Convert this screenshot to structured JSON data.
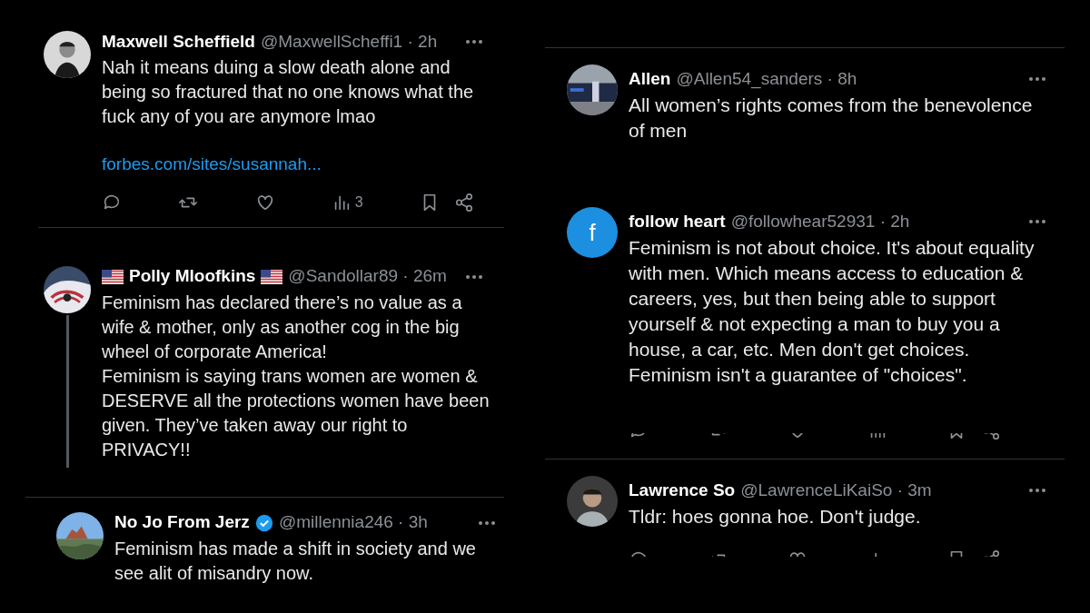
{
  "columns": [
    {
      "tweets": [
        {
          "name": "Maxwell Scheffield",
          "meta": "@MaxwellScheffi1 · 2h",
          "text": "Nah it means duing a slow death alone and being so fractured that no one knows what the fuck any of you are anymore lmao",
          "link": "forbes.com/sites/susannah...",
          "views": "3",
          "actions": true
        },
        {
          "name": "Polly Mloofkins",
          "flags": true,
          "meta": "@Sandollar89 · 26m",
          "text": "Feminism has declared there’s no value as a wife & mother, only as another cog in the big wheel of corporate America!\nFeminism is saying trans women are women & DESERVE all the protections women have been given. They’ve taken away our right to PRIVACY!!",
          "thread_line": true
        },
        {
          "name": "No Jo From Jerz",
          "verified": true,
          "meta": "@millennia246 · 3h",
          "text": "Feminism has made a shift in society and we see alit of misandry now."
        }
      ]
    },
    {
      "tweets": [
        {
          "name": "Allen",
          "meta": "@Allen54_sanders · 8h",
          "text": "All women’s rights comes from the benevolence of men"
        },
        {
          "name": "follow heart",
          "meta": "@followhear52931 · 2h",
          "avatar": {
            "kind": "letter",
            "letter": "f",
            "color": "#1d8fe0"
          },
          "text": "Feminism is not about choice. It's about equality with men. Which means access to education & careers, yes, but then being able to support yourself & not expecting a man to buy you a house, a car, etc. Men don't get choices. Feminism isn't a guarantee of \"choices\".",
          "actions": true,
          "actions_cut_top": true
        },
        {
          "name": "Lawrence So",
          "meta": "@LawrenceLiKaiSo · 3m",
          "text": "Tldr: hoes gonna hoe. Don't judge.",
          "actions": true,
          "actions_cut_bottom": true
        }
      ]
    }
  ]
}
